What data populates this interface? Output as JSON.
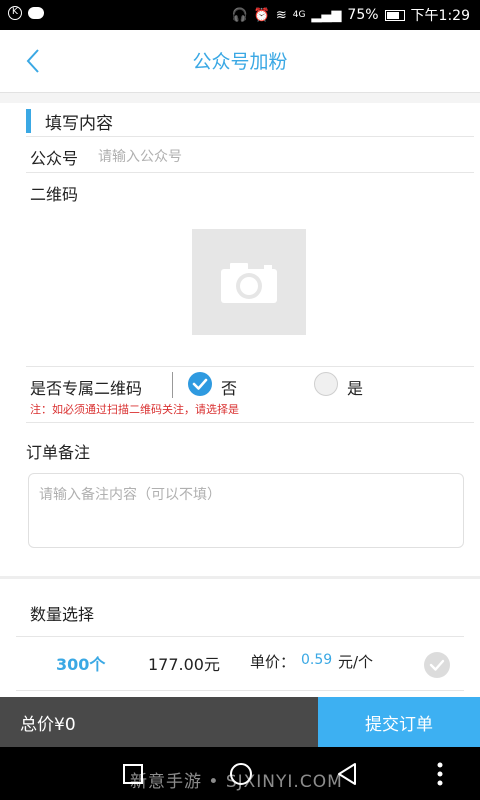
{
  "status_bar": {
    "battery": "75%",
    "time": "下午1:29",
    "network": "4G"
  },
  "header": {
    "title": "公众号加粉"
  },
  "form": {
    "section_title": "填写内容",
    "account_label": "公众号",
    "account_placeholder": "请输入公众号",
    "qr_label": "二维码",
    "exclusive_label": "是否专属二维码",
    "option_no": "否",
    "option_yes": "是",
    "selected_option": "否",
    "note": "注：如必须通过扫描二维码关注，请选择是",
    "remarks_label": "订单备注",
    "remarks_placeholder": "请输入备注内容（可以不填）"
  },
  "quantity": {
    "section_title": "数量选择",
    "items": [
      {
        "amount": "300个",
        "price": "177.00元",
        "unit_label": "单价：",
        "unit_value": "0.59",
        "unit_suffix": "元/个"
      }
    ]
  },
  "footer": {
    "total": "总价¥0",
    "submit": "提交订单"
  },
  "watermark": "新意手游 • SJXINYI.COM",
  "colors": {
    "accent": "#3aa8e4",
    "submit": "#3db0f2",
    "total_bar": "#494949",
    "note_red": "#d93030"
  }
}
